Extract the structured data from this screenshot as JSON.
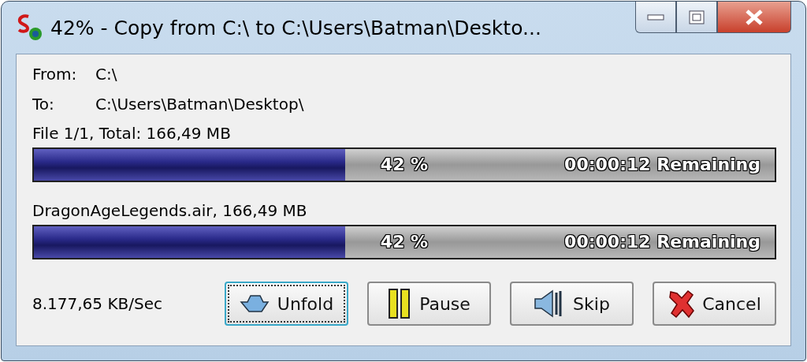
{
  "window": {
    "title": "42% - Copy from C:\\ to C:\\Users\\Batman\\Deskto..."
  },
  "paths": [
    {
      "label": "From:",
      "value": "C:\\"
    },
    {
      "label": "To:",
      "value": "C:\\Users\\Batman\\Desktop\\"
    }
  ],
  "progress": [
    {
      "caption": "File 1/1, Total: 166,49 MB",
      "percent": "42 %",
      "remaining": "00:00:12 Remaining",
      "level": 0.42
    },
    {
      "caption": "DragonAgeLegends.air, 166,49 MB",
      "percent": "42 %",
      "remaining": "00:00:12 Remaining",
      "level": 0.42
    }
  ],
  "speed": "8.177,65 KB/Sec",
  "buttons": [
    {
      "label": "Unfold",
      "kind": "unfold",
      "focused": true
    },
    {
      "label": "Pause",
      "kind": "pause",
      "focused": false
    },
    {
      "label": "Skip",
      "kind": "skip",
      "focused": false
    },
    {
      "label": "Cancel",
      "kind": "cancel",
      "focused": false
    }
  ]
}
